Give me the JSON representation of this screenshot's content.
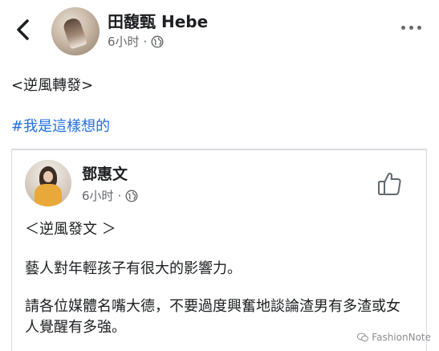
{
  "header": {
    "poster_name": "田馥甄 Hebe",
    "time": "6小时",
    "separator": "·",
    "globe_icon": "globe-icon",
    "more_icon": "more-dots-icon",
    "back_icon": "chevron-left-icon"
  },
  "post": {
    "line1": "<逆風轉發>",
    "hashtag": "#我是這樣想的"
  },
  "shared_post": {
    "author": "鄧惠文",
    "time": "6小时",
    "separator": "·",
    "like_icon": "thumbs-up-icon",
    "title": "＜逆風發文 ＞",
    "paragraph1": "藝人對年輕孩子有很大的影響力。",
    "paragraph2": "請各位媒體名嘴大德，不要過度興奮地談論渣男有多渣或女人覺醒有多強。"
  },
  "watermark": {
    "text": "FashionNote"
  },
  "colors": {
    "text": "#1c1e21",
    "secondary": "#65676b",
    "hashtag": "#216fdb",
    "border": "#d9dbe0"
  }
}
